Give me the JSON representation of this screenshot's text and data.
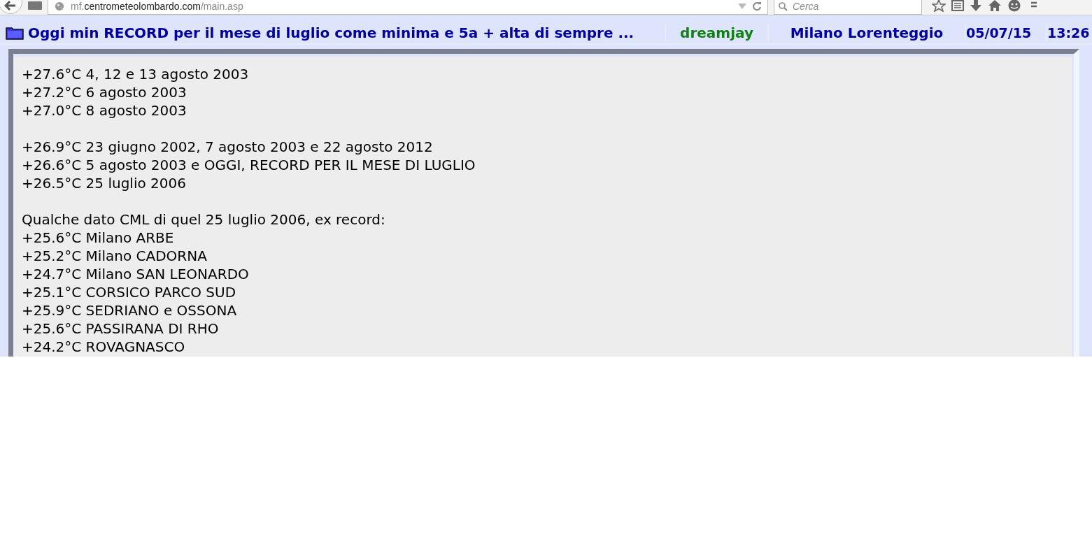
{
  "browser": {
    "url_subdomain": "mf.",
    "url_domain": "centrometeolombardo.com",
    "url_path": "/main.asp",
    "search": {
      "placeholder": "Cerca"
    }
  },
  "post_header": {
    "title": "Oggi min RECORD per il mese di luglio come minima e 5a + alta di sempre ...",
    "author": "dreamjay",
    "location": "Milano Lorenteggio",
    "date": "05/07/15",
    "time": "13:26"
  },
  "post_body": [
    [
      "+27.6°C 4, 12 e 13 agosto 2003",
      "+27.2°C 6 agosto 2003",
      "+27.0°C 8 agosto 2003"
    ],
    [
      "+26.9°C 23 giugno 2002, 7 agosto 2003 e 22 agosto 2012",
      "+26.6°C 5 agosto 2003 e OGGI, RECORD PER IL MESE DI LUGLIO",
      "+26.5°C 25 luglio 2006"
    ],
    [
      "Qualche dato CML di quel 25 luglio 2006, ex record:",
      "+25.6°C Milano ARBE",
      "+25.2°C Milano CADORNA",
      "+24.7°C Milano SAN LEONARDO",
      "+25.1°C CORSICO PARCO SUD",
      "+25.9°C SEDRIANO e OSSONA",
      "+25.6°C PASSIRANA DI RHO",
      "+24.2°C ROVAGNASCO"
    ]
  ]
}
